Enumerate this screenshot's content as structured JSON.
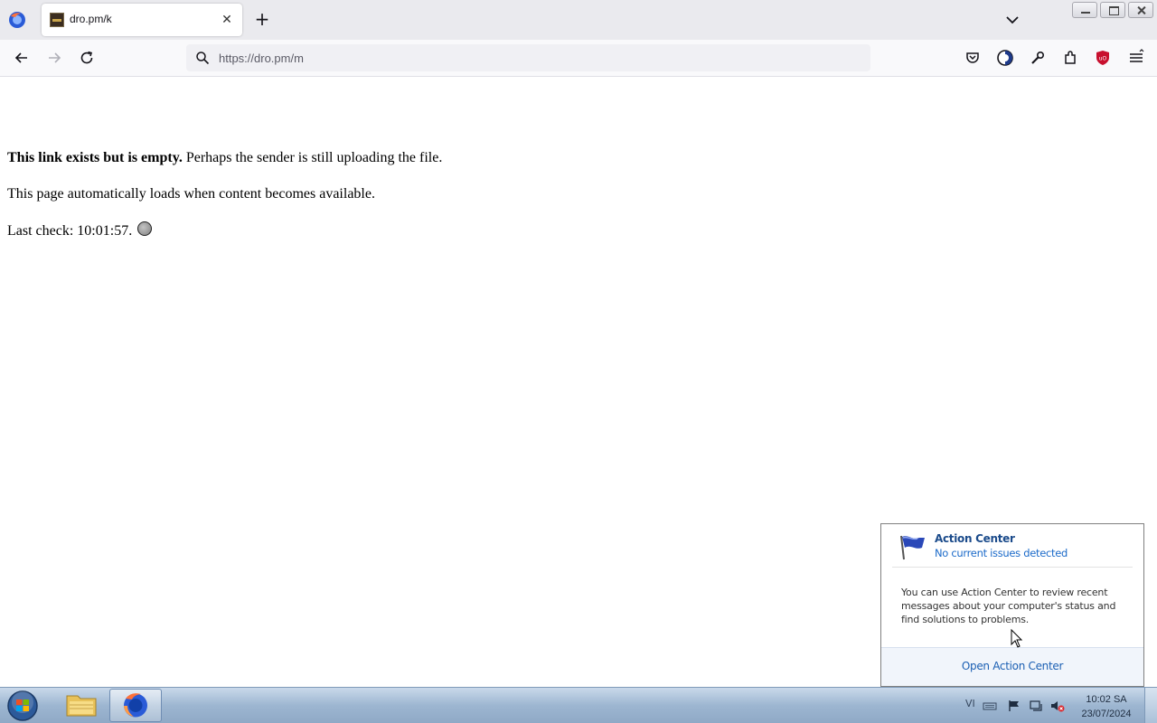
{
  "browser": {
    "tab": {
      "title": "dro.pm/k",
      "close_glyph": "✕"
    },
    "new_tab_glyph": "+",
    "url": {
      "value": "https://dro.pm/m"
    }
  },
  "page": {
    "line1_bold": "This link exists but is empty.",
    "line1_rest": " Perhaps the sender is still uploading the file.",
    "line2": "This page automatically loads when content becomes available.",
    "line3": "Last check: 10:01:57."
  },
  "action_center": {
    "title": "Action Center",
    "status": "No current issues detected",
    "description": "You can use Action Center to review recent messages about your computer's status and find solutions to problems.",
    "link": "Open Action Center"
  },
  "taskbar": {
    "language": "VI",
    "clock_time": "10:02 SA",
    "clock_date": "23/07/2024"
  },
  "colors": {
    "accent_blue": "#1b5fb3",
    "ublock_red": "#c8102e",
    "firefox_orange": "#ff7139"
  }
}
